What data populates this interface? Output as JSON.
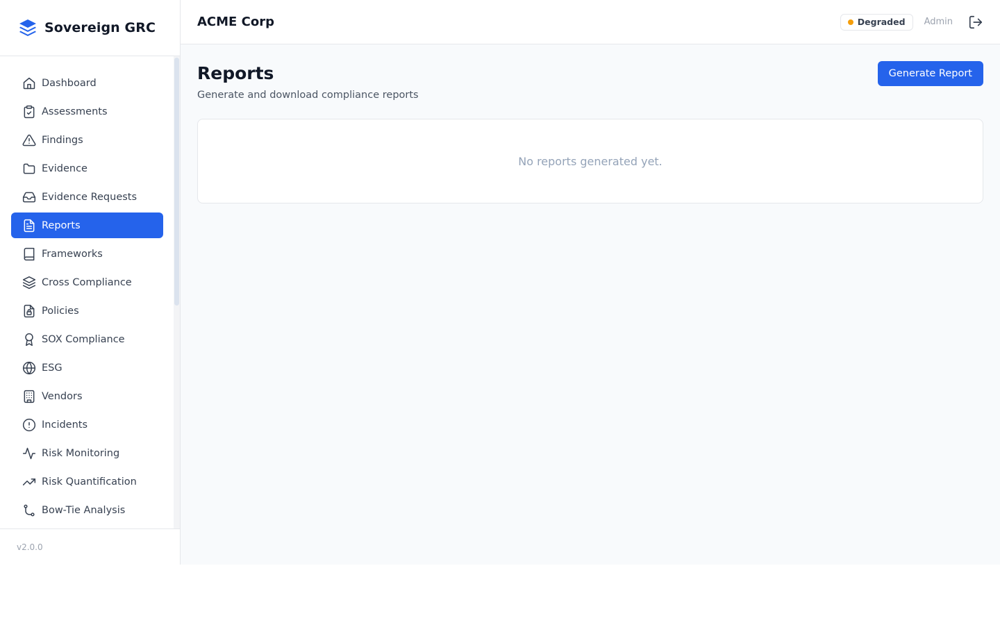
{
  "brand": {
    "name": "Sovereign GRC",
    "logo_icon": "stacked-layers-logo",
    "accent": "#2563eb"
  },
  "sidebar": {
    "items": [
      {
        "label": "Dashboard",
        "icon": "home-icon",
        "active": false
      },
      {
        "label": "Assessments",
        "icon": "clipboard-check-icon",
        "active": false
      },
      {
        "label": "Findings",
        "icon": "alert-triangle-icon",
        "active": false
      },
      {
        "label": "Evidence",
        "icon": "folder-icon",
        "active": false
      },
      {
        "label": "Evidence Requests",
        "icon": "inbox-icon",
        "active": false
      },
      {
        "label": "Reports",
        "icon": "file-text-icon",
        "active": true
      },
      {
        "label": "Frameworks",
        "icon": "book-icon",
        "active": false
      },
      {
        "label": "Cross Compliance",
        "icon": "layers-icon",
        "active": false
      },
      {
        "label": "Policies",
        "icon": "file-lock-icon",
        "active": false
      },
      {
        "label": "SOX Compliance",
        "icon": "award-icon",
        "active": false
      },
      {
        "label": "ESG",
        "icon": "globe-icon",
        "active": false
      },
      {
        "label": "Vendors",
        "icon": "building-icon",
        "active": false
      },
      {
        "label": "Incidents",
        "icon": "alert-circle-icon",
        "active": false
      },
      {
        "label": "Risk Monitoring",
        "icon": "activity-icon",
        "active": false
      },
      {
        "label": "Risk Quantification",
        "icon": "trending-up-icon",
        "active": false
      },
      {
        "label": "Bow-Tie Analysis",
        "icon": "git-branch-icon",
        "active": false
      }
    ],
    "version": "v2.0.0"
  },
  "header": {
    "org_name": "ACME Corp",
    "status": {
      "label": "Degraded",
      "color": "#f59e0b"
    },
    "user_role": "Admin",
    "logout_icon": "log-out-icon"
  },
  "page": {
    "title": "Reports",
    "subtitle": "Generate and download compliance reports",
    "primary_action": "Generate Report",
    "empty_state": "No reports generated yet."
  }
}
